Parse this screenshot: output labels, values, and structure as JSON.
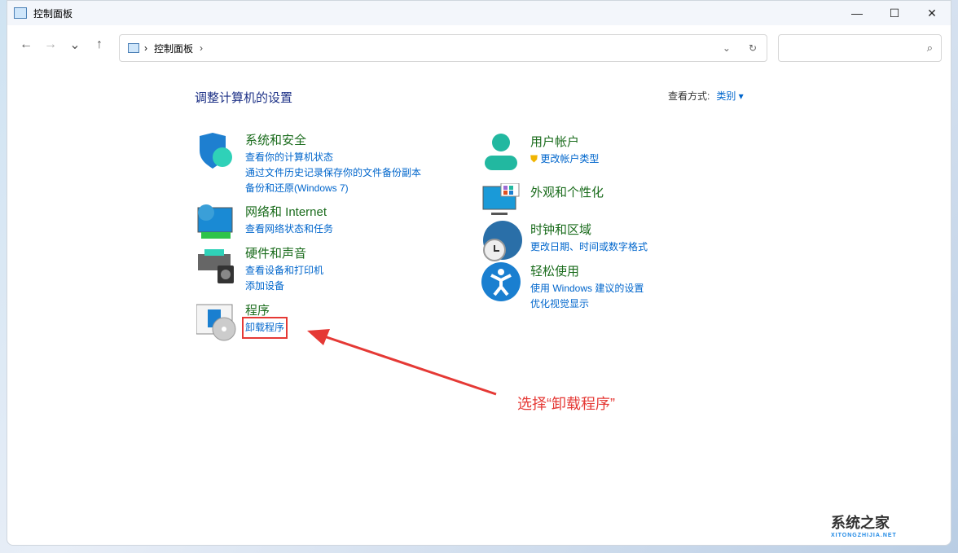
{
  "window": {
    "title": "控制面板",
    "controls": [
      "—",
      "☐",
      "✕"
    ]
  },
  "nav": {
    "back": "←",
    "forward": "→",
    "recent": "⌄",
    "up": "↑"
  },
  "address": {
    "crumb": "控制面板",
    "sep": "›",
    "dropdown": "⌄",
    "refresh": "↻"
  },
  "search": {
    "placeholder": "",
    "icon": "⌕"
  },
  "page": {
    "heading": "调整计算机的设置",
    "view_label": "查看方式:",
    "view_value": "类别 ▾"
  },
  "categories": [
    {
      "title": "系统和安全",
      "links": [
        "查看你的计算机状态",
        "通过文件历史记录保存你的文件备份副本",
        "备份和还原(Windows 7)"
      ]
    },
    {
      "title": "网络和 Internet",
      "links": [
        "查看网络状态和任务"
      ]
    },
    {
      "title": "硬件和声音",
      "links": [
        "查看设备和打印机",
        "添加设备"
      ]
    },
    {
      "title": "程序",
      "links": [
        "卸载程序"
      ]
    },
    {
      "title": "用户帐户",
      "links": [
        "更改帐户类型"
      ]
    },
    {
      "title": "外观和个性化",
      "links": []
    },
    {
      "title": "时钟和区域",
      "links": [
        "更改日期、时间或数字格式"
      ]
    },
    {
      "title": "轻松使用",
      "links": [
        "使用 Windows 建议的设置",
        "优化视觉显示"
      ]
    }
  ],
  "annotation": "选择“卸载程序”",
  "watermark": {
    "name": "系统之家",
    "url": "XITONGZHIJIA.NET"
  }
}
